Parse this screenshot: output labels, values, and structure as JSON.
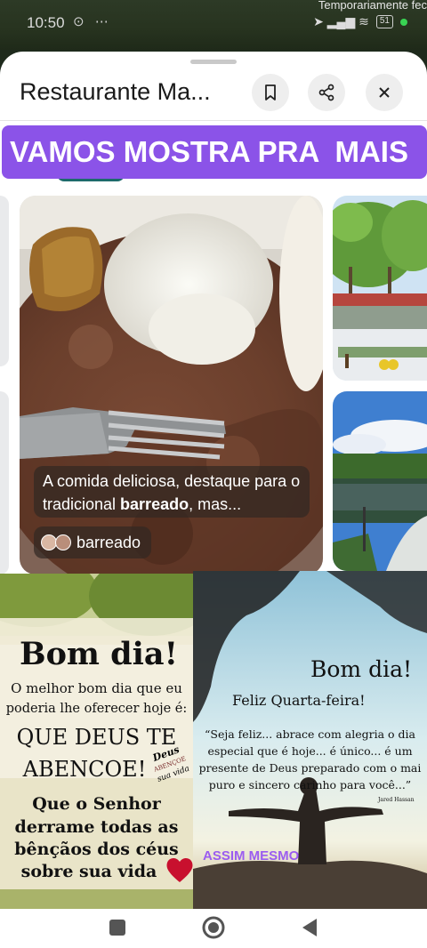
{
  "status_bar": {
    "time": "10:50",
    "status_icons": "⊙ ⋯",
    "banner": "Temporariamente fec",
    "battery": "51",
    "signal_icons": "➤ ▂▄▆ ≋"
  },
  "sheet": {
    "title": "Restaurante Ma...",
    "actions": {
      "bookmark": "bookmark-icon",
      "share": "share-icon",
      "close": "close-icon"
    }
  },
  "banner_text": "VAMOS MOSTRA PRA  MAIS",
  "main_card": {
    "caption_before": "A comida deliciosa, destaque para o tradicional ",
    "caption_bold": "barreado",
    "caption_after": ", mas...",
    "tag_label": "barreado"
  },
  "card_left": {
    "title": "Bom dia!",
    "line1": "O melhor bom dia que eu",
    "line2": "poderia lhe oferecer hoje é:",
    "line3": "QUE DEUS TE",
    "line4": "ABENCOE!",
    "stamp1": "Deus",
    "stamp2": "ABENÇOE",
    "stamp3": "sua vida",
    "line5": "Que o Senhor",
    "line6": "derrame todas as",
    "line7": "bênçãos dos céus",
    "line8": "sobre sua vida"
  },
  "card_right": {
    "title": "Bom dia!",
    "subtitle": "Feliz Quarta-feira!",
    "quote1": "“Seja feliz... abrace com alegria o dia",
    "quote2": "especial que é hoje... é único... é um",
    "quote3": "presente de Deus preparado com o mai",
    "quote4": "puro e sincero carinho para você...”",
    "author": "Jared Hassan",
    "overlay": "ASSIM MESMO"
  },
  "colors": {
    "banner_purple": "#8b53e8",
    "overlay_purple": "#9b5cf0"
  }
}
